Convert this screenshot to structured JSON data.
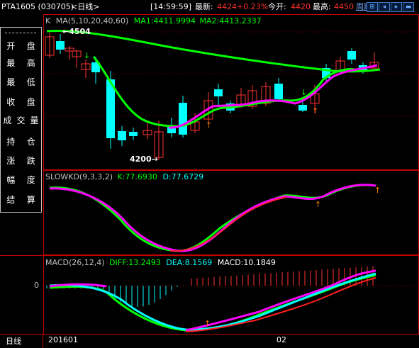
{
  "header": {
    "symbol": "PTA1605 (030705)",
    "period": "<日线>",
    "time": "[14:59:59]",
    "latest_label": "最新:",
    "latest_value": "4424",
    "change_pct": "+0.23%",
    "open_label": "今开:",
    "open_value": "4420",
    "high_label": "最高:",
    "high_value": "4450",
    "cycle_label": "周期",
    "nav_icons": [
      "zoom-in-icon",
      "zoom-out-icon",
      "arrow-left-icon",
      "arrow-right-icon",
      "minus-icon"
    ]
  },
  "menu": {
    "items": [
      "开盘",
      "最高",
      "最低",
      "收盘",
      "成交量",
      "持仓",
      "涨跌",
      "幅度",
      "结算"
    ]
  },
  "kline_panel": {
    "label": "K",
    "ma_spec": "MA(5,10,20,40,60)",
    "ma1": "MA1:4411.9994",
    "ma2": "MA2:4413.2337",
    "high_marker": "4504",
    "low_marker": "4200",
    "colors": {
      "ma1": "#ff00ff",
      "ma2": "#00ff00",
      "up": "#ff3232",
      "down": "#00ffff"
    }
  },
  "kd_panel": {
    "spec": "SLOWKD(9,3,3,2)",
    "k": "K:77.6930",
    "d": "D:77.6729",
    "colors": {
      "k": "#ff00ff",
      "d": "#00ff00"
    }
  },
  "macd_panel": {
    "spec": "MACD(26,12,4)",
    "diff": "DIFF:13.2493",
    "dea": "DEA:8.1569",
    "macd": "MACD:10.1849",
    "zero_label": "0",
    "colors": {
      "diff": "#00ff00",
      "dea": "#00ffff",
      "macd": "#ffffff"
    }
  },
  "footer": {
    "period_tab": "日线",
    "date_start": "201601",
    "date_mid": "02"
  }
}
